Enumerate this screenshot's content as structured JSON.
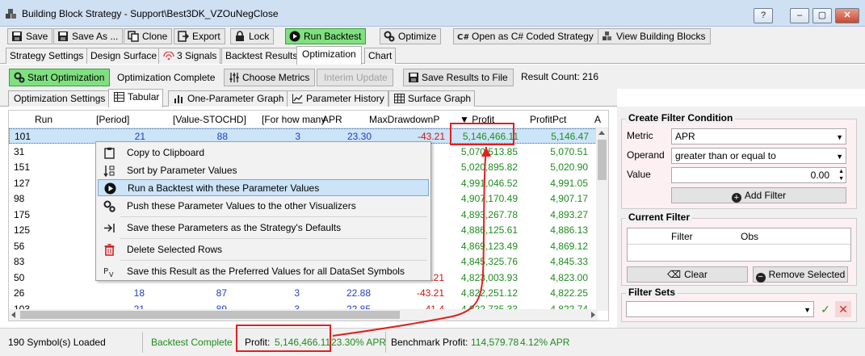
{
  "window": {
    "title": "Building Block Strategy - Support\\Best3DK_VZOuNegClose",
    "controls": [
      "?",
      "–",
      "▢",
      "✕"
    ]
  },
  "toolbar": {
    "save": "Save",
    "save_as": "Save As ...",
    "clone": "Clone",
    "export": "Export",
    "lock": "Lock",
    "run_backtest": "Run Backtest",
    "optimize": "Optimize",
    "open_csharp": "Open as C# Coded Strategy",
    "view_blocks": "View Building Blocks"
  },
  "tabs": [
    "Strategy Settings",
    "Design Surface",
    "3 Signals",
    "Backtest Results",
    "Optimization",
    "Chart"
  ],
  "optimization": {
    "start": "Start Optimization",
    "status": "Optimization Complete",
    "choose_metrics": "Choose Metrics",
    "interim_update": "Interim Update",
    "save_results": "Save Results to File",
    "result_count": "Result Count: 216"
  },
  "subtabs": [
    "Optimization Settings",
    "Tabular",
    "One-Parameter Graph",
    "Parameter History",
    "Surface Graph"
  ],
  "grid": {
    "headers": [
      "Run",
      "[Period]",
      "[Value-STOCHD]",
      "[For how many b",
      "APR",
      "MaxDrawdownP",
      "▼ Profit",
      "ProfitPct",
      "A"
    ],
    "rows": [
      {
        "run": "101",
        "period": "21",
        "value": "88",
        "forhow": "3",
        "apr": "23.30",
        "mdd": "-43.21",
        "profit": "5,146,466.11",
        "pct": "5,146.47"
      },
      {
        "run": "31",
        "period": "",
        "value": "",
        "forhow": "",
        "apr": "",
        "mdd": "",
        "profit": "5,070,513.85",
        "pct": "5,070.51"
      },
      {
        "run": "151",
        "period": "",
        "value": "",
        "forhow": "",
        "apr": "",
        "mdd": "",
        "profit": "5,020,895.82",
        "pct": "5,020.90"
      },
      {
        "run": "127",
        "period": "",
        "value": "",
        "forhow": "",
        "apr": "",
        "mdd": "",
        "profit": "4,991,046.52",
        "pct": "4,991.05"
      },
      {
        "run": "98",
        "period": "",
        "value": "",
        "forhow": "",
        "apr": "",
        "mdd": "",
        "profit": "4,907,170.49",
        "pct": "4,907.17"
      },
      {
        "run": "175",
        "period": "",
        "value": "",
        "forhow": "",
        "apr": "",
        "mdd": "",
        "profit": "4,893,267.78",
        "pct": "4,893.27"
      },
      {
        "run": "125",
        "period": "",
        "value": "",
        "forhow": "",
        "apr": "",
        "mdd": "",
        "profit": "4,886,125.61",
        "pct": "4,886.13"
      },
      {
        "run": "56",
        "period": "",
        "value": "",
        "forhow": "",
        "apr": "",
        "mdd": "",
        "profit": "4,869,123.49",
        "pct": "4,869.12"
      },
      {
        "run": "83",
        "period": "",
        "value": "",
        "forhow": "",
        "apr": "",
        "mdd": "",
        "profit": "4,845,325.76",
        "pct": "4,845.33"
      },
      {
        "run": "50",
        "period": "",
        "value": "",
        "forhow": "",
        "apr": "",
        "mdd": "-43.21",
        "profit": "4,823,003.93",
        "pct": "4,823.00"
      },
      {
        "run": "26",
        "period": "18",
        "value": "87",
        "forhow": "3",
        "apr": "22.88",
        "mdd": "-43.21",
        "profit": "4,822,251.12",
        "pct": "4,822.25"
      },
      {
        "run": "103",
        "period": "21",
        "value": "89",
        "forhow": "3",
        "apr": "22.85",
        "mdd": "-41.4",
        "profit": "4,822,735.33",
        "pct": "4,822.74"
      }
    ]
  },
  "context_menu": [
    {
      "label": "Copy to Clipboard",
      "icon": "clipboard-icon"
    },
    {
      "label": "Sort by Parameter Values",
      "icon": "sort-icon"
    },
    {
      "label": "Run a Backtest with these Parameter Values",
      "icon": "play-icon"
    },
    {
      "label": "Push these Parameter Values to the other Visualizers",
      "icon": "gears-icon"
    },
    {
      "label": "Save these Parameters as the Strategy's Defaults",
      "icon": "arrow-to-line-icon"
    },
    {
      "label": "Delete Selected Rows",
      "icon": "trash-icon"
    },
    {
      "label": "Save this Result as the Preferred Values for all DataSet Symbols",
      "icon": "pv-icon"
    }
  ],
  "filter": {
    "create_title": "Create Filter Condition",
    "metric_label": "Metric",
    "metric_value": "APR",
    "operand_label": "Operand",
    "operand_value": "greater than or equal to",
    "value_label": "Value",
    "value_value": "0.00",
    "add_filter": "Add Filter",
    "current_title": "Current Filter",
    "col_filter": "Filter",
    "col_obs": "Obs",
    "clear": "Clear",
    "remove_selected": "Remove Selected",
    "sets_title": "Filter Sets"
  },
  "status": {
    "symbols": "190 Symbol(s) Loaded",
    "backtest": "Backtest Complete",
    "profit_label": "Profit:",
    "profit_value": "5,146,466.11",
    "apr": "23.30% APR",
    "benchmark_label": "Benchmark Profit:",
    "benchmark_value": "114,579.78",
    "benchmark_apr": "4.12% APR"
  },
  "colors": {
    "accent_green": "#7fe07f",
    "annotation_red": "#e02020",
    "selection": "#cce4f7"
  }
}
